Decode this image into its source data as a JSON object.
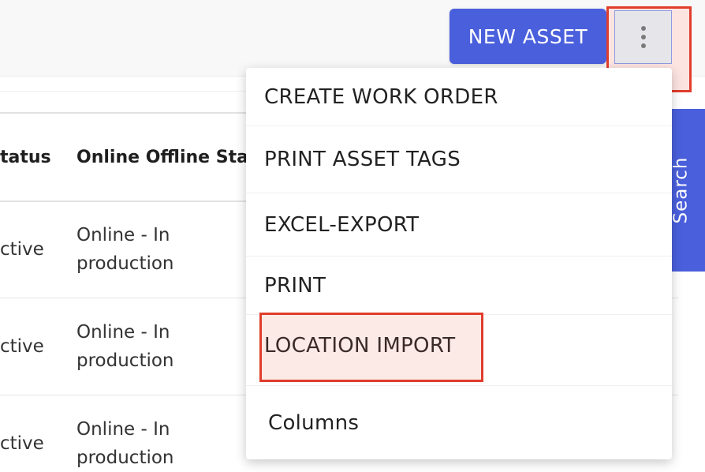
{
  "toolbar": {
    "new_asset_label": "NEW ASSET",
    "more_icon": "vertical-dots-icon"
  },
  "table": {
    "columns": [
      "tatus",
      "Online Offline Sta"
    ],
    "rows": [
      {
        "status": "ctive",
        "online": "Online - In production"
      },
      {
        "status": "ctive",
        "online": "Online - In production"
      },
      {
        "status": "ctive",
        "online": "Online - In production"
      }
    ]
  },
  "side_tab": {
    "label": "Search"
  },
  "menu": {
    "items": [
      {
        "label": "CREATE WORK ORDER"
      },
      {
        "label": "PRINT ASSET TAGS"
      },
      {
        "label": "EXCEL-EXPORT"
      },
      {
        "label": "PRINT"
      },
      {
        "label": "LOCATION IMPORT"
      },
      {
        "label": "Columns"
      }
    ]
  },
  "colors": {
    "accent": "#4a5fdc",
    "highlight_border": "#e03d2d",
    "highlight_fill": "#fce1de"
  }
}
